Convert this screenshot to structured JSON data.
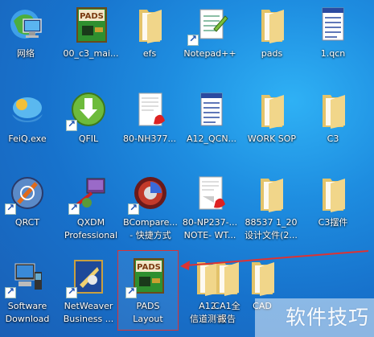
{
  "desktop": {
    "icons": [
      {
        "label": "网络",
        "icon": "network-icon",
        "shortcut": false
      },
      {
        "label": "00_c3_mai...",
        "icon": "pads-app-icon",
        "shortcut": false
      },
      {
        "label": "efs",
        "icon": "folder-icon",
        "shortcut": false
      },
      {
        "label": "Notepad++",
        "icon": "notepad-icon",
        "shortcut": true
      },
      {
        "label": "pads",
        "icon": "folder-icon",
        "shortcut": false
      },
      {
        "label": "1.qcn",
        "icon": "document-icon",
        "shortcut": false
      },
      {
        "label": "FeiQ.exe",
        "icon": "feiq-icon",
        "shortcut": false
      },
      {
        "label": "QFIL",
        "icon": "qfil-icon",
        "shortcut": true
      },
      {
        "label": "80-NH377...",
        "icon": "pdf-icon",
        "shortcut": false
      },
      {
        "label": "A12_QCN...",
        "icon": "document-icon",
        "shortcut": false
      },
      {
        "label": "WORK SOP",
        "icon": "folder-icon",
        "shortcut": false
      },
      {
        "label": "C3",
        "icon": "folder-icon",
        "shortcut": false
      },
      {
        "label": "QRCT",
        "icon": "qrct-icon",
        "shortcut": true
      },
      {
        "label": "QXDM\nProfessional",
        "icon": "qxdm-icon",
        "shortcut": true
      },
      {
        "label": "BCompare...\n- 快捷方式",
        "icon": "bcompare-icon",
        "shortcut": true
      },
      {
        "label": "80-NP237-...\nNOTE- WT...",
        "icon": "pdf-icon",
        "shortcut": false
      },
      {
        "label": "88537 1_20\n设计文件(2...",
        "icon": "folder-icon",
        "shortcut": false
      },
      {
        "label": "C3摆件",
        "icon": "folder-icon",
        "shortcut": false
      },
      {
        "label": "Software\nDownload",
        "icon": "software-download-icon",
        "shortcut": true
      },
      {
        "label": "NetWeaver\nBusiness ...",
        "icon": "netweaver-icon",
        "shortcut": true
      },
      {
        "label": "PADS\nLayout",
        "icon": "pads-app-icon",
        "shortcut": true
      },
      {
        "label": "A12\n信道测试",
        "icon": "folder-icon",
        "shortcut": false
      },
      {
        "label": "CA1全\n报告",
        "icon": "folder-icon",
        "shortcut": false
      },
      {
        "label": "CAD",
        "icon": "folder-icon",
        "shortcut": false
      }
    ],
    "pads_badge_text": "PADS",
    "watermark": "软件技巧"
  },
  "colors": {
    "desktop_bg": "#1e8de0",
    "highlight_border": "#dd3333",
    "arrow": "#dd3333"
  }
}
